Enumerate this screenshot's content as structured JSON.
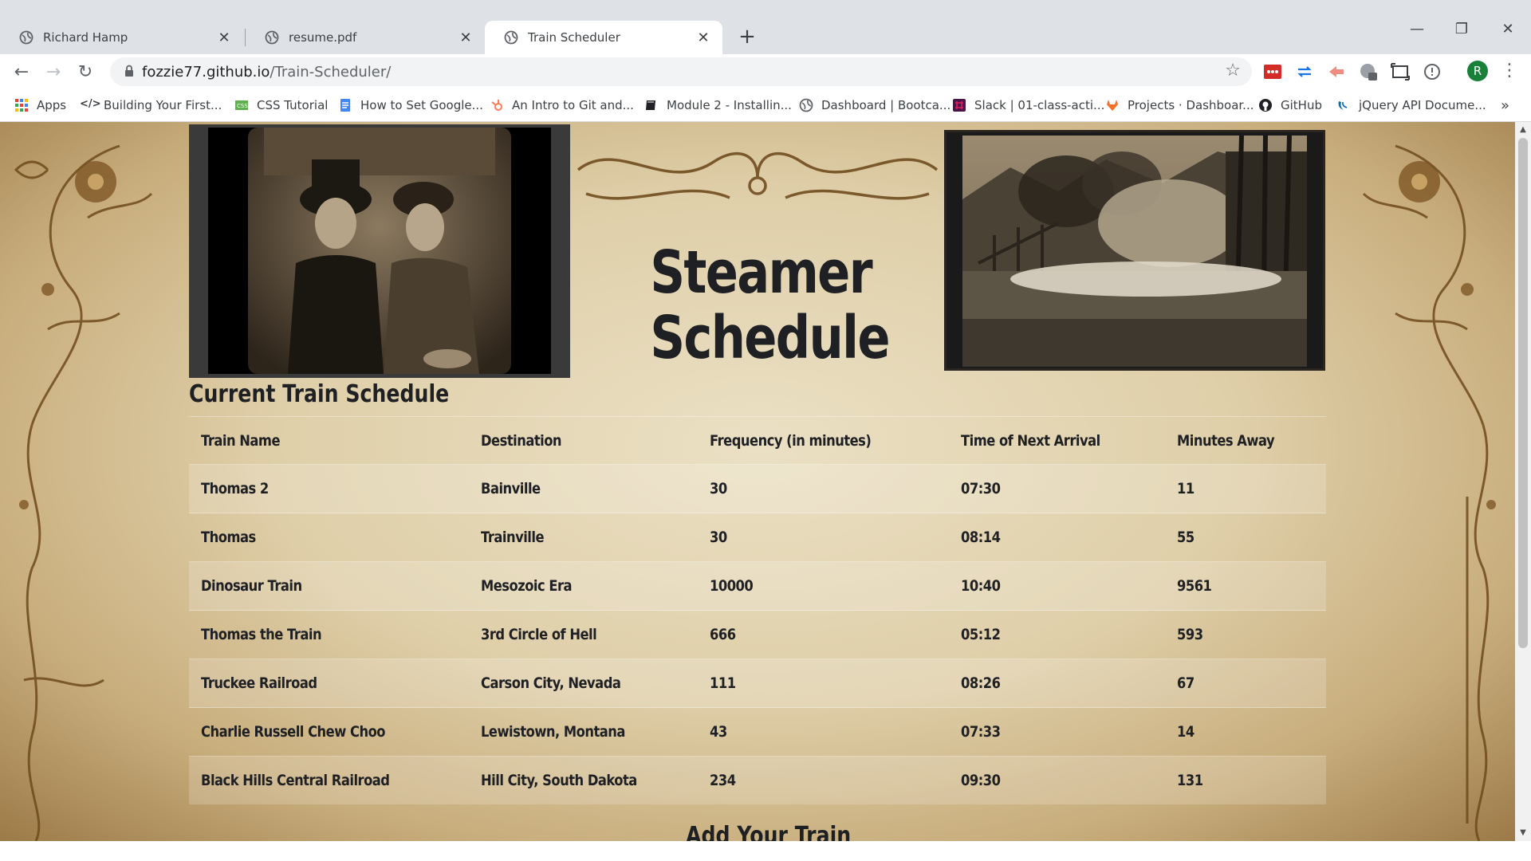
{
  "browser": {
    "tabs": [
      {
        "title": "Richard Hamp",
        "active": false
      },
      {
        "title": "resume.pdf",
        "active": false
      },
      {
        "title": "Train Scheduler",
        "active": true
      }
    ],
    "url_host": "fozzie77.github.io",
    "url_path": "/Train-Scheduler/",
    "profile_initial": "R",
    "bookmarks": [
      "Apps",
      "Building Your First...",
      "CSS Tutorial",
      "How to Set Google...",
      "An Intro to Git and...",
      "Module 2 - Installin...",
      "Dashboard | Bootca...",
      "Slack | 01-class-acti...",
      "Projects · Dashboar...",
      "GitHub",
      "jQuery API Docume..."
    ],
    "bookmarks_overflow": "»"
  },
  "page": {
    "title_line1": "Steamer",
    "title_line2": "Schedule",
    "schedule_heading": "Current Train Schedule",
    "add_heading": "Add Your Train",
    "table": {
      "headers": [
        "Train Name",
        "Destination",
        "Frequency (in minutes)",
        "Time of Next Arrival",
        "Minutes Away"
      ],
      "rows": [
        [
          "Thomas 2",
          "Bainville",
          "30",
          "07:30",
          "11"
        ],
        [
          "Thomas",
          "Trainville",
          "30",
          "08:14",
          "55"
        ],
        [
          "Dinosaur Train",
          "Mesozoic Era",
          "10000",
          "10:40",
          "9561"
        ],
        [
          "Thomas the Train",
          "3rd Circle of Hell",
          "666",
          "05:12",
          "593"
        ],
        [
          "Truckee Railroad",
          "Carson City, Nevada",
          "111",
          "08:26",
          "67"
        ],
        [
          "Charlie Russell Chew Choo",
          "Lewistown, Montana",
          "43",
          "07:33",
          "14"
        ],
        [
          "Black Hills Central Railroad",
          "Hill City, South Dakota",
          "234",
          "09:30",
          "131"
        ]
      ]
    }
  },
  "colors": {
    "text_dark": "#1f2024",
    "parchment": "#dfcfa9",
    "chrome_bg": "#dee1e6"
  }
}
